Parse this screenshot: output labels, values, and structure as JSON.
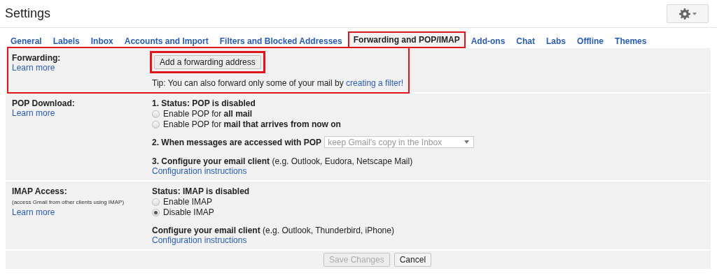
{
  "header": {
    "title": "Settings"
  },
  "tabs": [
    {
      "label": "General",
      "selected": false,
      "annotated": false
    },
    {
      "label": "Labels",
      "selected": false,
      "annotated": false
    },
    {
      "label": "Inbox",
      "selected": false,
      "annotated": false
    },
    {
      "label": "Accounts and Import",
      "selected": false,
      "annotated": false
    },
    {
      "label": "Filters and Blocked Addresses",
      "selected": false,
      "annotated": false
    },
    {
      "label": "Forwarding and POP/IMAP",
      "selected": true,
      "annotated": true
    },
    {
      "label": "Add-ons",
      "selected": false,
      "annotated": false
    },
    {
      "label": "Chat",
      "selected": false,
      "annotated": false
    },
    {
      "label": "Labs",
      "selected": false,
      "annotated": false
    },
    {
      "label": "Offline",
      "selected": false,
      "annotated": false
    },
    {
      "label": "Themes",
      "selected": false,
      "annotated": false
    }
  ],
  "sections": [
    {
      "label": "Forwarding:",
      "learn_more": "Learn more",
      "annotated": true,
      "rows": [
        {
          "kind": "button",
          "label": "Add a forwarding address",
          "annotated": true
        },
        {
          "kind": "tip",
          "text": "Tip: You can also forward only some of your mail by",
          "link": "creating a filter!"
        }
      ]
    },
    {
      "label": "POP Download:",
      "learn_more": "Learn more",
      "annotated": false,
      "rows": [
        {
          "kind": "heading",
          "text": "1. Status: POP is disabled"
        },
        {
          "kind": "radio",
          "text": "Enable POP for **all mail**",
          "selected": false
        },
        {
          "kind": "radio",
          "text": "Enable POP for **mail that arrives from now on**",
          "selected": false
        },
        {
          "kind": "select",
          "label": "2. When messages are accessed with POP",
          "value": "keep Gmail's copy in the Inbox",
          "disabled": true
        },
        {
          "kind": "config",
          "text": "**3. Configure your email client** (e.g. Outlook, Eudora, Netscape Mail)",
          "link": "Configuration instructions"
        }
      ]
    },
    {
      "label": "IMAP Access:",
      "note": "(access Gmail from other clients using IMAP)",
      "learn_more": "Learn more",
      "annotated": false,
      "rows": [
        {
          "kind": "heading",
          "text": "Status: IMAP is disabled"
        },
        {
          "kind": "radio",
          "text": "Enable IMAP",
          "selected": false
        },
        {
          "kind": "radio",
          "text": "Disable IMAP",
          "selected": true
        },
        {
          "kind": "config",
          "text": "**Configure your email client** (e.g. Outlook, Thunderbird, iPhone)",
          "link": "Configuration instructions"
        }
      ]
    }
  ],
  "footer_buttons": [
    {
      "label": "Save Changes",
      "disabled": true
    },
    {
      "label": "Cancel",
      "disabled": false
    }
  ]
}
